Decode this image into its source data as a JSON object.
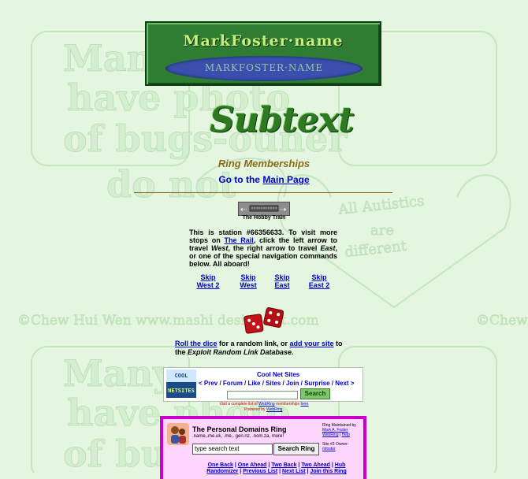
{
  "background": {
    "watermark_lines": [
      "Many",
      "have photo",
      "of bugs-ouner",
      "do not"
    ],
    "credit": "©Chew Hui Wen www.mashi design art.com",
    "heart_text": [
      "All Autistics",
      "are",
      "different"
    ]
  },
  "banner": {
    "title": "MarkFoster·name",
    "subtitle": "MARKFOSTER·NAME"
  },
  "logo": {
    "text": "Subtext"
  },
  "heading": {
    "text": "Ring Memberships"
  },
  "main_link": {
    "prefix": "Go to the ",
    "link_text": "Main Page"
  },
  "hobby_train": {
    "caption": "The Hobby Train",
    "station_text_1": "This is station #66356633. To visit more stops on ",
    "the_rail": "The Rail",
    "station_text_2": ", click the left arrow to travel ",
    "west": "West",
    "station_text_3": ", the right arrow to travel ",
    "east": "East",
    "station_text_4": ", or one of the special navigation commands below. All aboard!",
    "skip_links": [
      {
        "line1": "Skip",
        "line2": "West 2"
      },
      {
        "line1": "Skip",
        "line2": "West"
      },
      {
        "line1": "Skip",
        "line2": "East"
      },
      {
        "line1": "Skip",
        "line2": "East 2"
      }
    ]
  },
  "random_link": {
    "roll": "Roll the dice",
    "middle": " for a random link, or ",
    "add": "add your site",
    "end": " to the ",
    "db": "Exploit Random Link Database."
  },
  "cool_net_sites": {
    "icon_top": "COOL",
    "icon_bottom": "NETSITES",
    "title": "Cool Net Sites",
    "nav": [
      "< Prev",
      "Forum",
      "Like",
      "Sites",
      "Join",
      "Surprise",
      "Next >"
    ],
    "search_label": "Search"
  },
  "webring_note": {
    "line1_prefix": "Visit a complete list of ",
    "webring": "WebRing",
    "line1_mid": " memberships ",
    "here": "here",
    "line2_prefix": "Powered by ",
    "powered": "WebRing",
    "line2_end": "."
  },
  "personal_domains": {
    "title": "The Personal Domains Ring",
    "subtitle": ".name,.me.uk, .me,. gen.nz, .nom.za, more!",
    "search_placeholder": "type search text",
    "search_button": "Search Ring",
    "maintained": "Ring Maintained by ",
    "maintainer": "Mark A. Foster",
    "webring": "WebRing",
    "help": "Help",
    "site_owner": "Site #2 Owner: ",
    "owner": "mfoster",
    "links_row1": [
      "One Back",
      "One Ahead",
      "Two Back",
      "Two Ahead",
      "Hub"
    ],
    "links_row2": [
      "Randomizer",
      "Previous List",
      "Next List",
      "Join this Ring"
    ]
  },
  "colors": {
    "background": "#e4f6e0",
    "banner": "#2f7d32",
    "heading": "#8a6b16",
    "link": "#0000cc",
    "ring_border": "#cc00cc",
    "ring_bg": "#ffd6ff"
  }
}
